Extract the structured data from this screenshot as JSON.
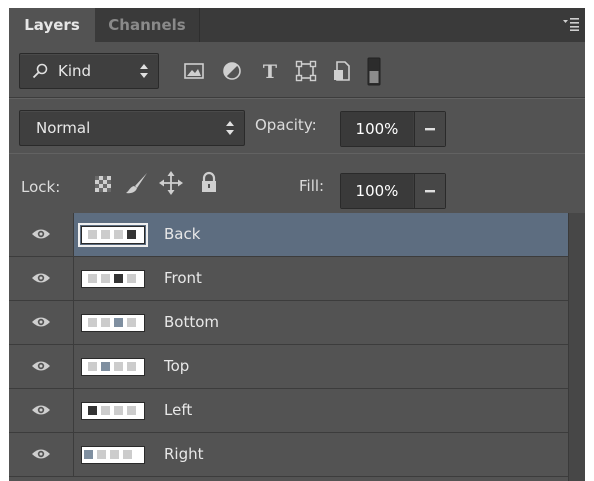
{
  "tabs": [
    {
      "label": "Layers",
      "active": true
    },
    {
      "label": "Channels",
      "active": false
    }
  ],
  "filter": {
    "kind_label": "Kind",
    "icons": [
      "pixel-filter-icon",
      "adjustment-filter-icon",
      "type-filter-icon",
      "shape-filter-icon",
      "smart-object-filter-icon",
      "filter-toggle-icon"
    ]
  },
  "blend": {
    "mode": "Normal",
    "opacity_label": "Opacity:",
    "opacity_value": "100%"
  },
  "lock": {
    "label": "Lock:",
    "icons": [
      "lock-transparent-pixels-icon",
      "lock-image-pixels-icon",
      "lock-position-icon",
      "lock-all-icon"
    ],
    "fill_label": "Fill:",
    "fill_value": "100%"
  },
  "layers": [
    {
      "name": "Back",
      "selected": true
    },
    {
      "name": "Front",
      "selected": false
    },
    {
      "name": "Bottom",
      "selected": false
    },
    {
      "name": "Top",
      "selected": false
    },
    {
      "name": "Left",
      "selected": false
    },
    {
      "name": "Right",
      "selected": false
    }
  ],
  "colors": {
    "panel_bg": "#535353",
    "selected_row": "#5d6d80",
    "field_bg": "#3f3f3f"
  }
}
